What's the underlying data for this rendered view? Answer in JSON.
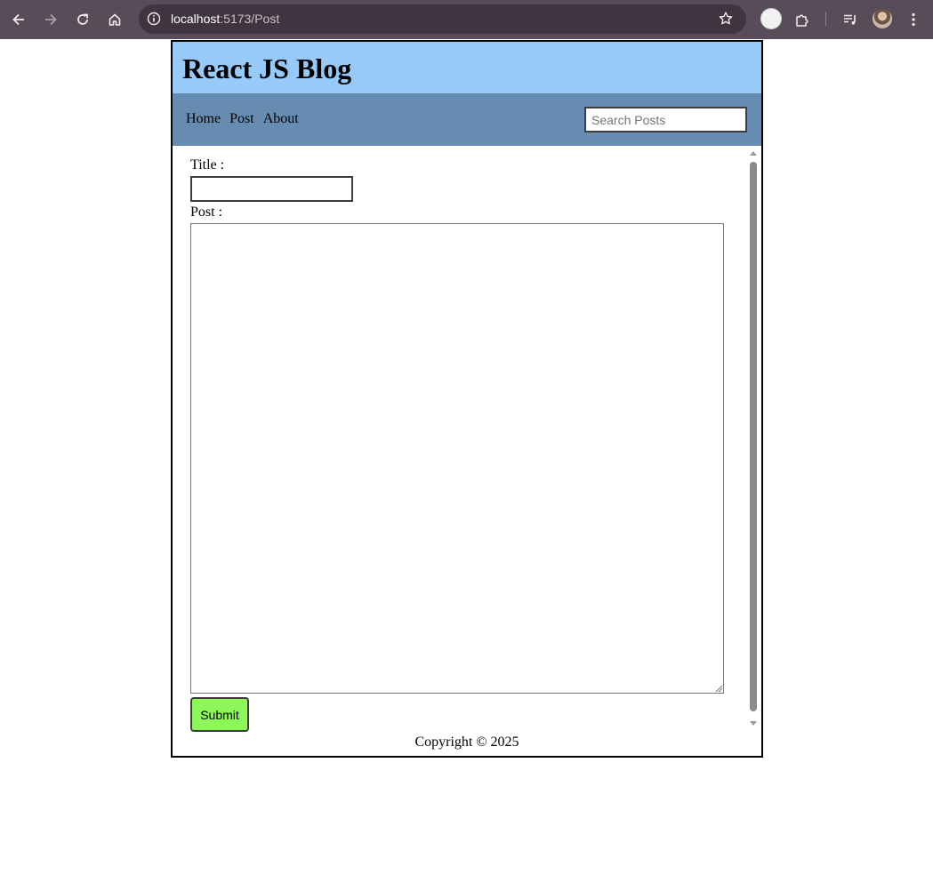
{
  "browser": {
    "url_host": "localhost",
    "url_path": ":5173/Post"
  },
  "app": {
    "title": "React JS Blog",
    "nav": {
      "links": [
        "Home",
        "Post",
        "About"
      ],
      "search_placeholder": "Search Posts"
    },
    "form": {
      "title_label": "Title :",
      "title_value": "",
      "post_label": "Post :",
      "post_value": "",
      "submit_label": "Submit"
    },
    "footer": "Copyright © 2025"
  },
  "colors": {
    "header_bg": "#97caf9",
    "nav_bg": "#678cb1",
    "submit_bg": "#8cf756",
    "chrome_bg": "#574c57"
  }
}
